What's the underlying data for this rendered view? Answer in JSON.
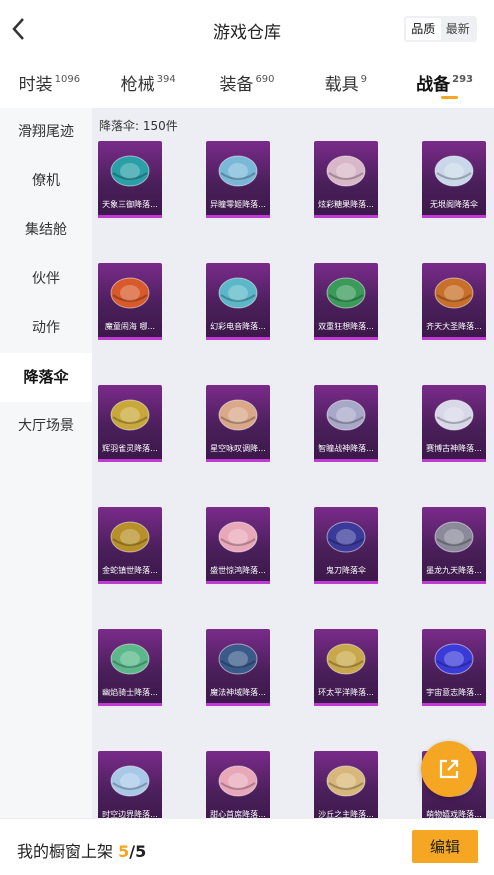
{
  "header": {
    "title": "游戏仓库",
    "sort_options": [
      "品质",
      "最新"
    ],
    "sort_active": "品质"
  },
  "tabs": [
    {
      "label": "时装",
      "count": "1096"
    },
    {
      "label": "枪械",
      "count": "394"
    },
    {
      "label": "装备",
      "count": "690"
    },
    {
      "label": "载具",
      "count": "9"
    },
    {
      "label": "战备",
      "count": "293",
      "active": true
    }
  ],
  "sidebar": [
    {
      "label": "滑翔尾迹"
    },
    {
      "label": "僚机"
    },
    {
      "label": "集结舱"
    },
    {
      "label": "伙伴"
    },
    {
      "label": "动作"
    },
    {
      "label": "降落伞",
      "active": true
    },
    {
      "label": "大厅场景"
    }
  ],
  "content": {
    "count_label": "降落伞: 150件"
  },
  "items": [
    {
      "name": "天象三御降落...",
      "color": "#2a9fa8"
    },
    {
      "name": "异瞳零姬降落...",
      "color": "#7ab8d8"
    },
    {
      "name": "炫彩糖果降落...",
      "color": "#d8b8c8"
    },
    {
      "name": "无垠阁降落伞",
      "color": "#c8d8e8"
    },
    {
      "name": "魔童闹海 哪...",
      "color": "#d85a2a"
    },
    {
      "name": "幻彩电音降落...",
      "color": "#5ab8c8"
    },
    {
      "name": "双重狂想降落...",
      "color": "#3a9a5a"
    },
    {
      "name": "齐天大圣降落...",
      "color": "#c8702a"
    },
    {
      "name": "辉羽雀灵降落...",
      "color": "#c8a83a"
    },
    {
      "name": "星空咏叹调降...",
      "color": "#d8a888"
    },
    {
      "name": "智瞳战神降落...",
      "color": "#a8a8c8"
    },
    {
      "name": "赛博古神降落...",
      "color": "#d8d8e8"
    },
    {
      "name": "金蛇镇世降落...",
      "color": "#b8902a"
    },
    {
      "name": "盛世惊鸿降落...",
      "color": "#e8a8b8"
    },
    {
      "name": "鬼刀降落伞",
      "color": "#3a3a9a"
    },
    {
      "name": "墨龙九天降落...",
      "color": "#8a8a9a"
    },
    {
      "name": "幽焰骑士降落...",
      "color": "#5ab88a"
    },
    {
      "name": "魔法神域降落...",
      "color": "#3a5a8a"
    },
    {
      "name": "环太平洋降落...",
      "color": "#c8a84a"
    },
    {
      "name": "宇宙意志降落...",
      "color": "#3a3ad8"
    },
    {
      "name": "时空边界降落...",
      "color": "#a8c8e8"
    },
    {
      "name": "甜心首席降落...",
      "color": "#e8a8b8"
    },
    {
      "name": "沙丘之主降落...",
      "color": "#d8b87a"
    },
    {
      "name": "萌物嬉戏降落...",
      "color": "#e8c8a8"
    }
  ],
  "bottom": {
    "shelf_label": "我的橱窗上架 ",
    "shelf_current": "5",
    "shelf_total": "/5",
    "edit_label": "编辑"
  },
  "colors": {
    "accent": "#f5a623",
    "card": "#5a2468"
  }
}
